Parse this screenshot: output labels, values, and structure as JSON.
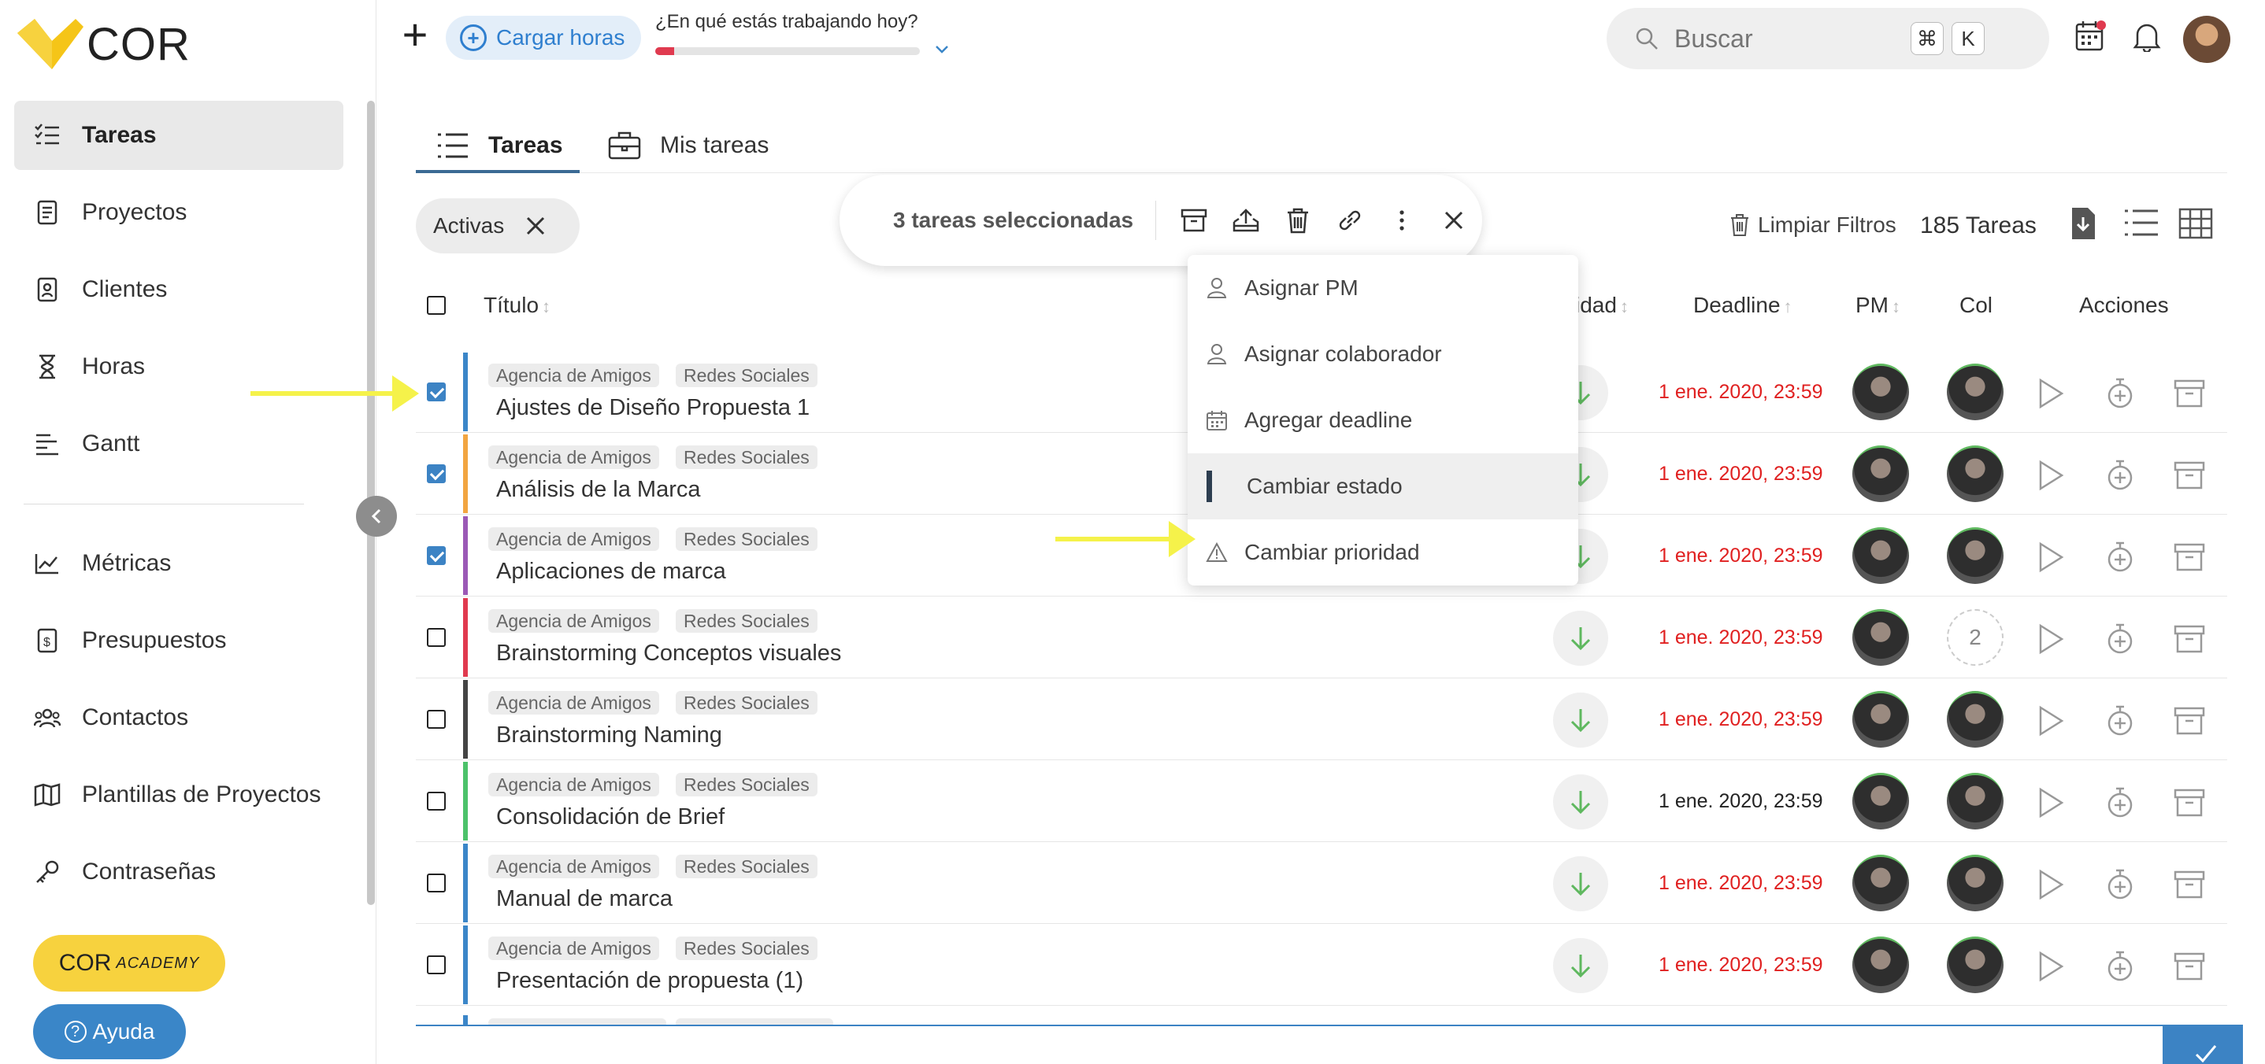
{
  "brand": {
    "name": "COR"
  },
  "sidebar": {
    "items": [
      {
        "label": "Tareas",
        "icon": "tasks-icon",
        "active": true
      },
      {
        "label": "Proyectos",
        "icon": "projects-icon"
      },
      {
        "label": "Clientes",
        "icon": "clients-icon"
      },
      {
        "label": "Horas",
        "icon": "hourglass-icon"
      },
      {
        "label": "Gantt",
        "icon": "gantt-icon"
      },
      {
        "label": "Métricas",
        "icon": "metrics-icon"
      },
      {
        "label": "Presupuestos",
        "icon": "budget-icon"
      },
      {
        "label": "Contactos",
        "icon": "contacts-icon"
      },
      {
        "label": "Plantillas de Proyectos",
        "icon": "templates-icon"
      },
      {
        "label": "Contraseñas",
        "icon": "key-icon"
      }
    ],
    "academy_label": "COR",
    "academy_sub": "ACADEMY",
    "help_label": "Ayuda"
  },
  "topbar": {
    "cargar_label": "Cargar horas",
    "working_prompt": "¿En qué estás trabajando hoy?",
    "progress_fraction": 0.07,
    "search_placeholder": "Buscar",
    "shortcut_cmd": "⌘",
    "shortcut_key": "K"
  },
  "tabs": [
    {
      "label": "Tareas",
      "active": true
    },
    {
      "label": "Mis tareas"
    }
  ],
  "filters": {
    "chip_label": "Activas",
    "clear_label": "Limpiar Filtros",
    "count_label": "185 Tareas"
  },
  "selection": {
    "label": "3 tareas seleccionadas"
  },
  "table": {
    "headers": {
      "title": "Título",
      "priority": "idad",
      "deadline": "Deadline",
      "pm": "PM",
      "col": "Col",
      "actions": "Acciones"
    },
    "rows": [
      {
        "tags": [
          "Agencia de Amigos",
          "Redes Sociales"
        ],
        "title": "Ajustes de Diseño Propuesta 1",
        "deadline": "1 ene. 2020, 23:59",
        "overdue": true,
        "checked": true,
        "color": "#3b86c8",
        "collab": "avatar"
      },
      {
        "tags": [
          "Agencia de Amigos",
          "Redes Sociales"
        ],
        "title": "Análisis de la Marca",
        "deadline": "1 ene. 2020, 23:59",
        "overdue": true,
        "checked": true,
        "color": "#f2a541",
        "collab": "avatar"
      },
      {
        "tags": [
          "Agencia de Amigos",
          "Redes Sociales"
        ],
        "title": "Aplicaciones de marca",
        "deadline": "1 ene. 2020, 23:59",
        "overdue": true,
        "checked": true,
        "color": "#9b59b6",
        "collab": "avatar"
      },
      {
        "tags": [
          "Agencia de Amigos",
          "Redes Sociales"
        ],
        "title": "Brainstorming Conceptos visuales",
        "deadline": "1 ene. 2020, 23:59",
        "overdue": true,
        "checked": false,
        "color": "#e03a4f",
        "collab": "2"
      },
      {
        "tags": [
          "Agencia de Amigos",
          "Redes Sociales"
        ],
        "title": "Brainstorming Naming",
        "deadline": "1 ene. 2020, 23:59",
        "overdue": true,
        "checked": false,
        "color": "#444444",
        "collab": "avatar"
      },
      {
        "tags": [
          "Agencia de Amigos",
          "Redes Sociales"
        ],
        "title": "Consolidación de Brief",
        "deadline": "1 ene. 2020, 23:59",
        "overdue": false,
        "checked": false,
        "color": "#4cc26a",
        "collab": "avatar"
      },
      {
        "tags": [
          "Agencia de Amigos",
          "Redes Sociales"
        ],
        "title": "Manual de marca",
        "deadline": "1 ene. 2020, 23:59",
        "overdue": true,
        "checked": false,
        "color": "#3b86c8",
        "collab": "avatar"
      },
      {
        "tags": [
          "Agencia de Amigos",
          "Redes Sociales"
        ],
        "title": "Presentación de propuesta (1)",
        "deadline": "1 ene. 2020, 23:59",
        "overdue": true,
        "checked": false,
        "color": "#3b86c8",
        "collab": "avatar"
      }
    ]
  },
  "menu": {
    "items": [
      {
        "label": "Asignar PM",
        "icon": "user-icon"
      },
      {
        "label": "Asignar colaborador",
        "icon": "user-icon"
      },
      {
        "label": "Agregar deadline",
        "icon": "calendar-icon"
      },
      {
        "label": "Cambiar estado",
        "icon": "status-bar-icon",
        "hover": true
      },
      {
        "label": "Cambiar prioridad",
        "icon": "warning-icon"
      }
    ]
  },
  "colors": {
    "accent": "#3c83c4",
    "overdue": "#e02020",
    "annotation_arrow": "#f5f24a",
    "academy": "#f7d23e"
  }
}
